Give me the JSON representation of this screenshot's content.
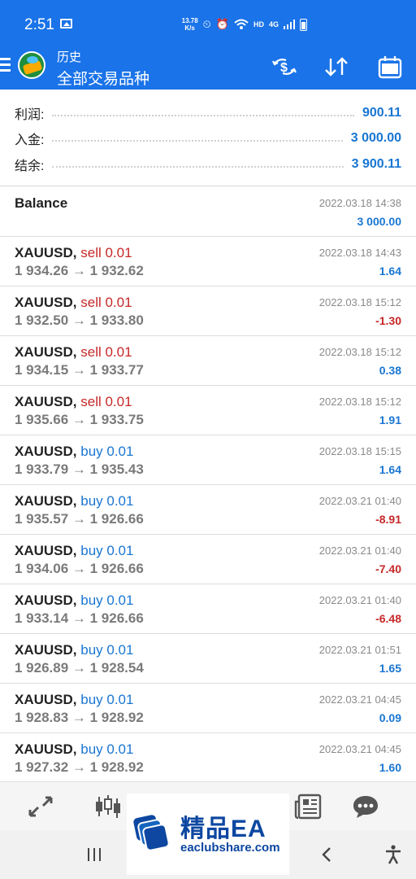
{
  "status_bar": {
    "time": "2:51",
    "net_speed_value": "13.78",
    "net_speed_unit": "K/s",
    "hd": "HD",
    "network": "4G"
  },
  "header": {
    "title": "历史",
    "subtitle": "全部交易品种",
    "icons": [
      "menu-icon",
      "app-logo",
      "sort-money-icon",
      "sort-arrows-icon",
      "calendar-icon"
    ]
  },
  "summary": {
    "profit_label": "利润:",
    "profit_value": "900.11",
    "deposit_label": "入金:",
    "deposit_value": "3 000.00",
    "balance_label": "结余:",
    "balance_value": "3 900.11"
  },
  "balance_entry": {
    "label": "Balance",
    "time": "2022.03.18 14:38",
    "amount": "3 000.00"
  },
  "trades": [
    {
      "symbol": "XAUUSD,",
      "direction": "sell 0.01",
      "type": "sell",
      "prices": "1 934.26 → 1 932.62",
      "time": "2022.03.18 14:43",
      "profit": "1.64",
      "sign": "pos"
    },
    {
      "symbol": "XAUUSD,",
      "direction": "sell 0.01",
      "type": "sell",
      "prices": "1 932.50 → 1 933.80",
      "time": "2022.03.18 15:12",
      "profit": "-1.30",
      "sign": "neg"
    },
    {
      "symbol": "XAUUSD,",
      "direction": "sell 0.01",
      "type": "sell",
      "prices": "1 934.15 → 1 933.77",
      "time": "2022.03.18 15:12",
      "profit": "0.38",
      "sign": "pos"
    },
    {
      "symbol": "XAUUSD,",
      "direction": "sell 0.01",
      "type": "sell",
      "prices": "1 935.66 → 1 933.75",
      "time": "2022.03.18 15:12",
      "profit": "1.91",
      "sign": "pos"
    },
    {
      "symbol": "XAUUSD,",
      "direction": "buy 0.01",
      "type": "buy",
      "prices": "1 933.79 → 1 935.43",
      "time": "2022.03.18 15:15",
      "profit": "1.64",
      "sign": "pos"
    },
    {
      "symbol": "XAUUSD,",
      "direction": "buy 0.01",
      "type": "buy",
      "prices": "1 935.57 → 1 926.66",
      "time": "2022.03.21 01:40",
      "profit": "-8.91",
      "sign": "neg"
    },
    {
      "symbol": "XAUUSD,",
      "direction": "buy 0.01",
      "type": "buy",
      "prices": "1 934.06 → 1 926.66",
      "time": "2022.03.21 01:40",
      "profit": "-7.40",
      "sign": "neg"
    },
    {
      "symbol": "XAUUSD,",
      "direction": "buy 0.01",
      "type": "buy",
      "prices": "1 933.14 → 1 926.66",
      "time": "2022.03.21 01:40",
      "profit": "-6.48",
      "sign": "neg"
    },
    {
      "symbol": "XAUUSD,",
      "direction": "buy 0.01",
      "type": "buy",
      "prices": "1 926.89 → 1 928.54",
      "time": "2022.03.21 01:51",
      "profit": "1.65",
      "sign": "pos"
    },
    {
      "symbol": "XAUUSD,",
      "direction": "buy 0.01",
      "type": "buy",
      "prices": "1 928.83 → 1 928.92",
      "time": "2022.03.21 04:45",
      "profit": "0.09",
      "sign": "pos"
    },
    {
      "symbol": "XAUUSD,",
      "direction": "buy 0.01",
      "type": "buy",
      "prices": "1 927.32 → 1 928.92",
      "time": "2022.03.21 04:45",
      "profit": "1.60",
      "sign": "pos"
    }
  ],
  "bottom_toolbar": {
    "icons": [
      "quotes-arrows-icon",
      "chart-candles-icon",
      "trade-icon",
      "history-icon",
      "news-icon",
      "chat-icon"
    ]
  },
  "nav_bar": {
    "icons": [
      "recent-apps-icon",
      "home-icon",
      "back-icon",
      "accessibility-icon"
    ]
  },
  "watermark": {
    "title": "精品EA",
    "url": "eaclubshare.com"
  },
  "colors": {
    "header_bg": "#1a73e8",
    "profit_positive": "#1976d2",
    "profit_negative": "#c62828",
    "sell": "#c62828",
    "buy": "#1976d2"
  }
}
